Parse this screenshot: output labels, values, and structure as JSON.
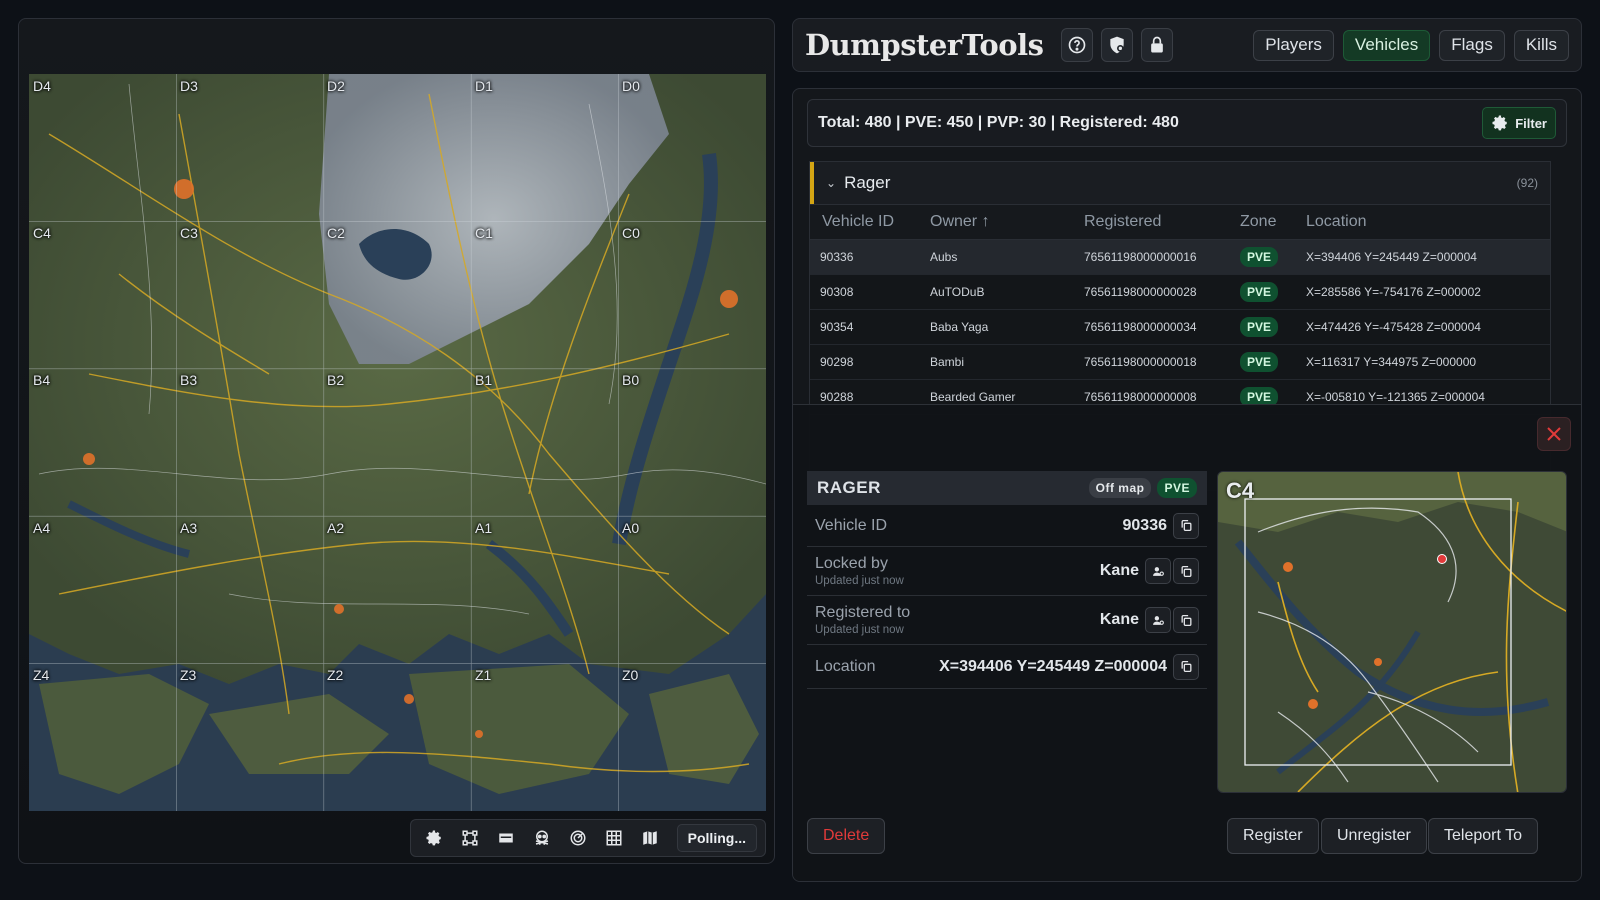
{
  "header": {
    "logo": "DumpsterTools",
    "nav": [
      {
        "label": "Players",
        "active": false
      },
      {
        "label": "Vehicles",
        "active": true
      },
      {
        "label": "Flags",
        "active": false
      },
      {
        "label": "Kills",
        "active": false
      }
    ]
  },
  "map": {
    "grid_labels": [
      "D4",
      "D3",
      "D2",
      "D1",
      "D0",
      "C4",
      "C3",
      "C2",
      "C1",
      "C0",
      "B4",
      "B3",
      "B2",
      "B1",
      "B0",
      "A4",
      "A3",
      "A2",
      "A1",
      "A0",
      "Z4",
      "Z3",
      "Z2",
      "Z1",
      "Z0"
    ],
    "toolbar_icons": [
      "gear-icon",
      "nodes-icon",
      "vehicle-icon",
      "skull-icon",
      "radar-icon",
      "grid-icon",
      "map-icon"
    ],
    "polling_label": "Polling..."
  },
  "vehicles": {
    "summary": "Total: 480 | PVE: 450 | PVP: 30 | Registered: 480",
    "filter_label": "Filter",
    "group": {
      "name": "Rager",
      "count": "(92)"
    },
    "columns": [
      "Vehicle ID",
      "Owner ↑",
      "Registered",
      "Zone",
      "Location"
    ],
    "rows": [
      {
        "id": "90336",
        "owner": "Aubs",
        "registered": "76561198000000016",
        "zone": "PVE",
        "location": "X=394406 Y=245449 Z=000004"
      },
      {
        "id": "90308",
        "owner": "AuTODuB",
        "registered": "76561198000000028",
        "zone": "PVE",
        "location": "X=285586 Y=-754176 Z=000002"
      },
      {
        "id": "90354",
        "owner": "Baba Yaga",
        "registered": "76561198000000034",
        "zone": "PVE",
        "location": "X=474426 Y=-475428 Z=000004"
      },
      {
        "id": "90298",
        "owner": "Bambi",
        "registered": "76561198000000018",
        "zone": "PVE",
        "location": "X=116317 Y=344975 Z=000000"
      },
      {
        "id": "90288",
        "owner": "Bearded Gamer",
        "registered": "76561198000000008",
        "zone": "PVE",
        "location": "X=-005810 Y=-121365 Z=000004"
      }
    ]
  },
  "detail": {
    "title": "RAGER",
    "status": "Off map",
    "zone": "PVE",
    "fields": {
      "vehicle_id_label": "Vehicle ID",
      "vehicle_id": "90336",
      "locked_by_label": "Locked by",
      "locked_by": "Kane",
      "locked_by_sub": "Updated just now",
      "registered_to_label": "Registered to",
      "registered_to": "Kane",
      "registered_to_sub": "Updated just now",
      "location_label": "Location",
      "location": "X=394406 Y=245449 Z=000004"
    },
    "minimap_cell": "C4",
    "buttons": {
      "delete": "Delete",
      "register": "Register",
      "unregister": "Unregister",
      "teleport": "Teleport To"
    }
  },
  "colors": {
    "accent_green": "#143a25",
    "group_accent": "#d4a514",
    "danger": "#e03a3a",
    "road": "#d6a924"
  }
}
